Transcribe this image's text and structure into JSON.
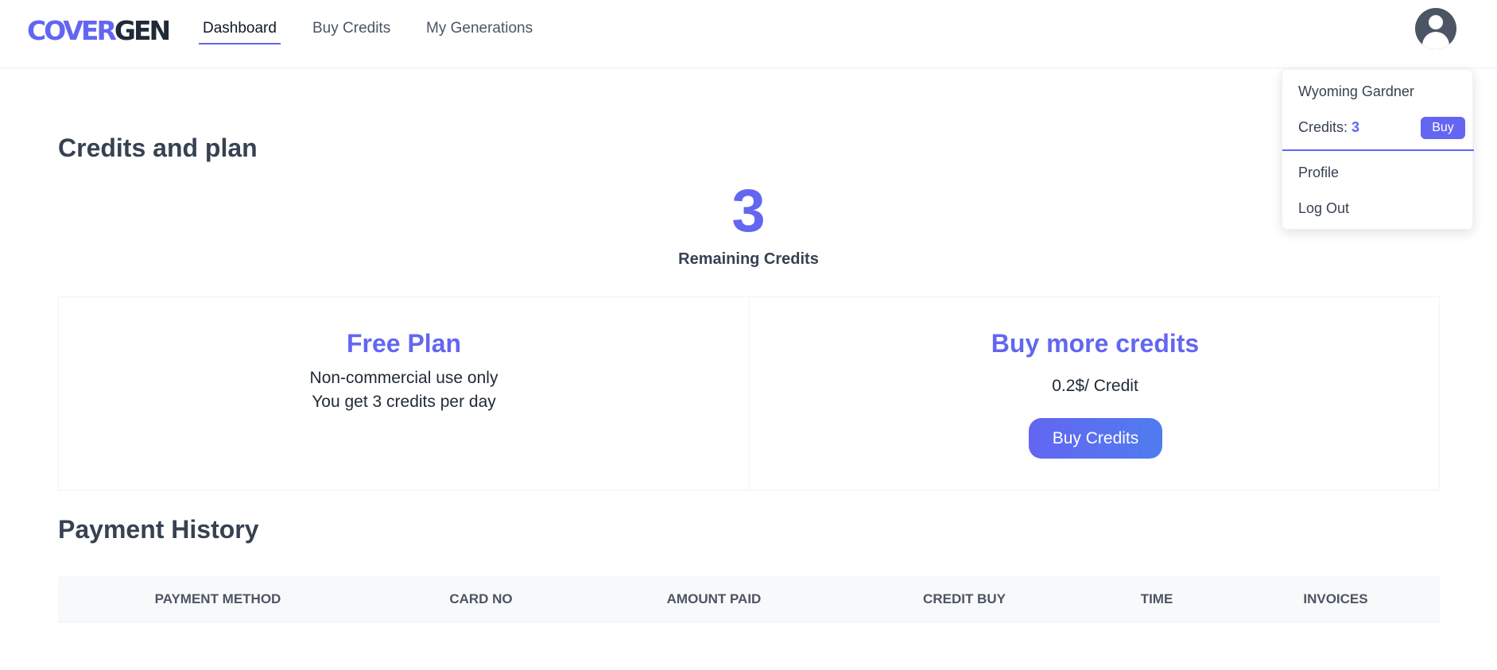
{
  "brand": {
    "logo_part_a": "COVER",
    "logo_part_b": "GEN",
    "accent": "#6366f1"
  },
  "nav": [
    {
      "label": "Dashboard",
      "active": true
    },
    {
      "label": "Buy Credits",
      "active": false
    },
    {
      "label": "My Generations",
      "active": false
    }
  ],
  "user_menu": {
    "avatar_icon": "user-avatar-icon",
    "name": "Wyoming Gardner",
    "credits_label": "Credits:",
    "credits_value": "3",
    "buy_label": "Buy",
    "profile_label": "Profile",
    "logout_label": "Log Out"
  },
  "credits": {
    "title": "Credits and plan",
    "remaining_value": "3",
    "remaining_label": "Remaining Credits"
  },
  "plan": {
    "title": "Free Plan",
    "line1": "Non-commercial use only",
    "line2": "You get 3 credits per day"
  },
  "buy_more": {
    "title": "Buy more credits",
    "price": "0.2$/ Credit",
    "button_label": "Buy Credits"
  },
  "payment_history": {
    "title": "Payment History",
    "columns": [
      "PAYMENT METHOD",
      "CARD NO",
      "AMOUNT PAID",
      "CREDIT BUY",
      "TIME",
      "INVOICES"
    ]
  }
}
